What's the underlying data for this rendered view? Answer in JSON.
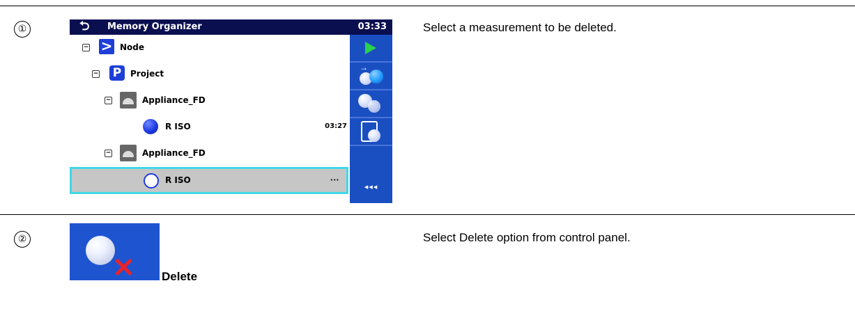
{
  "steps": [
    {
      "number": "①",
      "description": "Select a measurement to be deleted."
    },
    {
      "number": "②",
      "description": "Select Delete option from control panel."
    }
  ],
  "screen": {
    "title": "Memory Organizer",
    "clock": "03:33",
    "back_symbol": "⮌",
    "tree": [
      {
        "expander": "−",
        "label": "Node",
        "icon": "node-icon"
      },
      {
        "expander": "−",
        "label": "Project",
        "icon": "project-icon"
      },
      {
        "expander": "−",
        "label": "Appliance_FD",
        "icon": "appliance-icon"
      },
      {
        "label": "R ISO",
        "icon": "measurement-done-icon",
        "time": "03:27"
      },
      {
        "expander": "−",
        "label": "Appliance_FD",
        "icon": "appliance-icon"
      },
      {
        "label": "R ISO",
        "icon": "measurement-empty-icon",
        "time": "···",
        "selected": true
      }
    ],
    "panel": {
      "back_label": "◂◂◂",
      "buttons": [
        "play-icon",
        "new-measurement-icon",
        "clone-icon",
        "paste-icon",
        "back-icon"
      ]
    }
  },
  "delete": {
    "label": "Delete",
    "colors": {
      "background": "#1e54d0",
      "cross": "#e8232b"
    }
  }
}
